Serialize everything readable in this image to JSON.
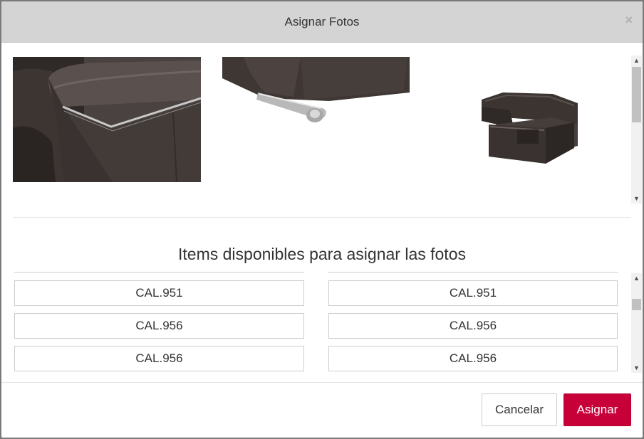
{
  "modal": {
    "title": "Asignar Fotos",
    "close_glyph": "×"
  },
  "photos": [
    {
      "subject": "sofa-armrest-closeup-photo"
    },
    {
      "subject": "sofa-chrome-leg-closeup-photo"
    },
    {
      "subject": "corner-sofa-photo"
    }
  ],
  "items_section": {
    "heading": "Items disponibles para asignar las fotos",
    "left_column": [
      "CAL.951",
      "CAL.956",
      "CAL.956"
    ],
    "right_column": [
      "CAL.951",
      "CAL.956",
      "CAL.956"
    ]
  },
  "footer": {
    "cancel_label": "Cancelar",
    "assign_label": "Asignar"
  },
  "scroll_arrows": {
    "up": "▲",
    "down": "▼"
  },
  "colors": {
    "header_bg": "#d4d4d4",
    "primary_button": "#c8003a",
    "leather": "#3b3431"
  }
}
